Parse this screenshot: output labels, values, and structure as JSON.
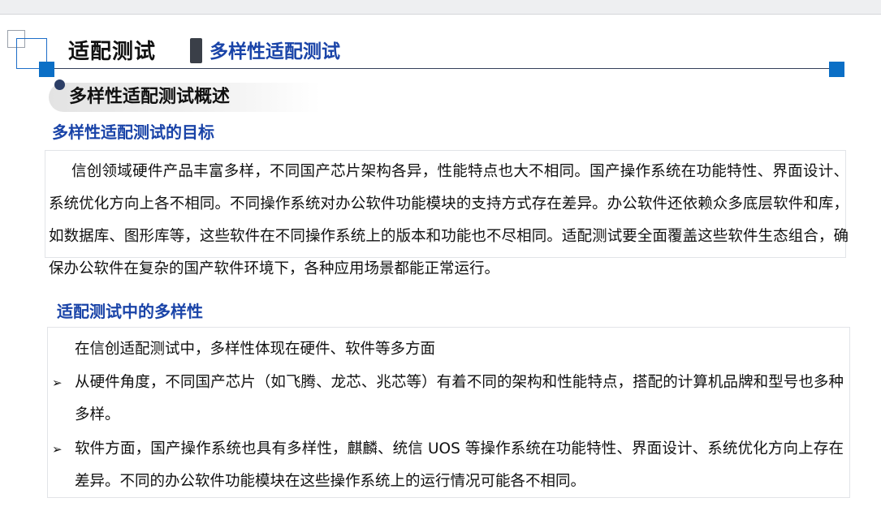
{
  "header": {
    "section_title": "适配测试",
    "section_subtitle": "多样性适配测试"
  },
  "overview": {
    "title": "多样性适配测试概述"
  },
  "goal": {
    "heading": "多样性适配测试的目标",
    "paragraph": "信创领域硬件产品丰富多样，不同国产芯片架构各异，性能特点也大不相同。国产操作系统在功能特性、界面设计、系统优化方向上各不相同。不同操作系统对办公软件功能模块的支持方式存在差异。办公软件还依赖众多底层软件和库，如数据库、图形库等，这些软件在不同操作系统上的版本和功能也不尽相同。适配测试要全面覆盖这些软件生态组合，确保办公软件在复杂的国产软件环境下，各种应用场景都能正常运行。"
  },
  "diversity": {
    "heading": "适配测试中的多样性",
    "intro": "在信创适配测试中，多样性体现在硬件、软件等多方面",
    "bullet_marker": "➢",
    "bullets": [
      "从硬件角度，不同国产芯片（如飞腾、龙芯、兆芯等）有着不同的架构和性能特点，搭配的计算机品牌和型号也多种多样。",
      "软件方面，国产操作系统也具有多样性，麒麟、统信 UOS 等操作系统在功能特性、界面设计、系统优化方向上存在差异。不同的办公软件功能模块在这些操作系统上的运行情况可能各不相同。"
    ]
  },
  "colors": {
    "accent_blue": "#1a44a8",
    "deco_blue": "#0b6fc6",
    "dark_bar": "#3a3f48"
  }
}
